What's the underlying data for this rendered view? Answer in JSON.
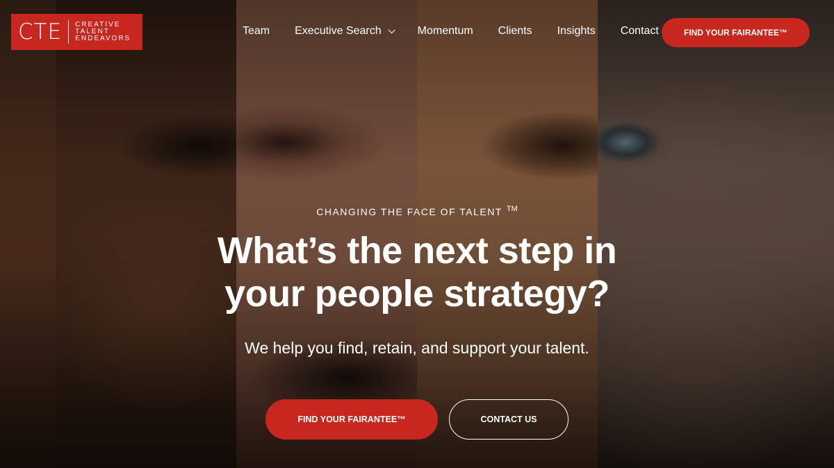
{
  "logo": {
    "mark": "CTE",
    "line1": "CREATIVE",
    "line2": "TALENT",
    "line3": "ENDEAVORS"
  },
  "nav": {
    "items": [
      {
        "label": "Team"
      },
      {
        "label": "Executive Search"
      },
      {
        "label": "Momentum"
      },
      {
        "label": "Clients"
      },
      {
        "label": "Insights"
      },
      {
        "label": "Contact"
      }
    ],
    "cta_label": "FIND YOUR FAIRANTEE™"
  },
  "hero": {
    "eyebrow": "CHANGING THE FACE OF TALENT",
    "eyebrow_mark": "TM",
    "headline_line1": "What’s the next step in",
    "headline_line2": "your people strategy?",
    "subhead": "We help you find, retain, and support your talent.",
    "primary_cta": "FIND YOUR FAIRANTEE™",
    "secondary_cta": "CONTACT US"
  },
  "colors": {
    "brand_red": "#c8271f",
    "text": "#ffffff"
  },
  "icons": {
    "dropdown": "chevron-down-icon"
  }
}
